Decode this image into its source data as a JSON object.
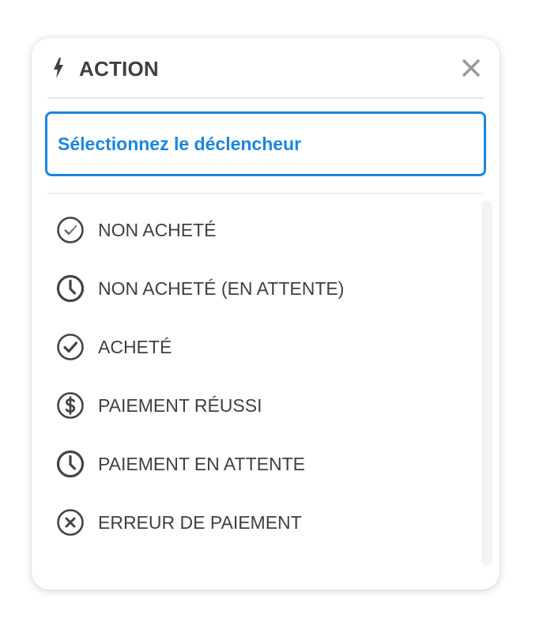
{
  "header": {
    "icon": "lightning-bolt-icon",
    "title": "ACTION",
    "close_icon": "close-icon"
  },
  "trigger": {
    "label": "Sélectionnez le déclencheur",
    "accent_color": "#1b86e0"
  },
  "items": [
    {
      "label": "NON ACHETÉ",
      "icon": "check-circle-outline-icon"
    },
    {
      "label": "NON ACHETÉ (EN ATTENTE)",
      "icon": "clock-icon"
    },
    {
      "label": "ACHETÉ",
      "icon": "check-circle-icon"
    },
    {
      "label": "PAIEMENT RÉUSSI",
      "icon": "dollar-circle-icon"
    },
    {
      "label": "PAIEMENT EN ATTENTE",
      "icon": "clock-icon"
    },
    {
      "label": "ERREUR DE PAIEMENT",
      "icon": "x-circle-icon"
    }
  ]
}
